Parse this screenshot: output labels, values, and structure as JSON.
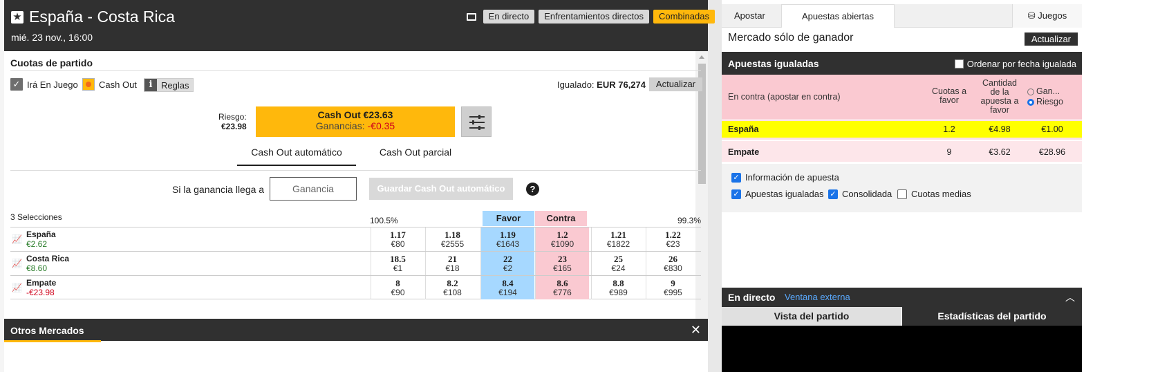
{
  "header": {
    "title": "España - Costa Rica",
    "date": "mié. 23 nov., 16:00",
    "buttons": [
      "En directo",
      "Enfrentamientos directos",
      "Combinadas"
    ]
  },
  "section_title": "Cuotas de partido",
  "options": {
    "ira": "Irá En Juego",
    "cashout": "Cash Out",
    "reglas": "Reglas",
    "igualado_label": "Igualado:",
    "igualado_value": "EUR 76,274",
    "actualizar": "Actualizar"
  },
  "riesgo": {
    "label": "Riesgo:",
    "value": "€23.98"
  },
  "cashout": {
    "main": "Cash Out €23.63",
    "gan_label": "Ganancias:",
    "gan_value": "-€0.35"
  },
  "tabs": [
    "Cash Out automático",
    "Cash Out parcial"
  ],
  "auto": {
    "si_label": "Si la ganancia llega a",
    "placeholder": "Ganancia",
    "guardar": "Guardar Cash Out automático",
    "help": "?"
  },
  "market": {
    "selections": "3 Selecciones",
    "pct_back": "100.5%",
    "pct_lay": "99.3%",
    "favor": "Favor",
    "contra": "Contra",
    "rows": [
      {
        "name": "España",
        "pl": "€2.62",
        "cells": [
          [
            "1.17",
            "€80"
          ],
          [
            "1.18",
            "€2555"
          ],
          [
            "1.19",
            "€1643"
          ],
          [
            "1.2",
            "€1090"
          ],
          [
            "1.21",
            "€1822"
          ],
          [
            "1.22",
            "€23"
          ]
        ]
      },
      {
        "name": "Costa Rica",
        "pl": "€8.60",
        "cells": [
          [
            "18.5",
            "€1"
          ],
          [
            "21",
            "€18"
          ],
          [
            "22",
            "€2"
          ],
          [
            "23",
            "€165"
          ],
          [
            "25",
            "€24"
          ],
          [
            "26",
            "€830"
          ]
        ]
      },
      {
        "name": "Empate",
        "pl": "-€23.98",
        "cells": [
          [
            "8",
            "€90"
          ],
          [
            "8.2",
            "€108"
          ],
          [
            "8.4",
            "€194"
          ],
          [
            "8.6",
            "€776"
          ],
          [
            "8.8",
            "€989"
          ],
          [
            "9",
            "€995"
          ]
        ]
      }
    ]
  },
  "otros": "Otros Mercados",
  "right": {
    "tabs": [
      "Apostar",
      "Apuestas abiertas",
      "Juegos"
    ],
    "mercado": "Mercado sólo de ganador",
    "actualizar": "Actualizar",
    "igualadas": "Apuestas igualadas",
    "ordenar": "Ordenar por fecha igualada",
    "head": {
      "c1": "En contra (apostar en contra)",
      "c2": "Cuotas a favor",
      "c3": "Cantidad de la apuesta a favor",
      "r1": "Gan...",
      "r2": "Riesgo"
    },
    "rows": [
      {
        "name": "España",
        "odds": "1.2",
        "stake": "€4.98",
        "risk": "€1.00"
      },
      {
        "name": "Empate",
        "odds": "9",
        "stake": "€3.62",
        "risk": "€28.96"
      }
    ],
    "checks": {
      "info": "Información de apuesta",
      "igual": "Apuestas igualadas",
      "cons": "Consolidada",
      "medias": "Cuotas medias"
    },
    "endirecto": "En directo",
    "ventana": "Ventana externa",
    "vista": "Vista del partido",
    "stats": "Estadísticas del partido"
  },
  "colors": {
    "header": "#303030",
    "accent": "#ffb80c",
    "favor": "#a6d8ff",
    "contra": "#fac9d1",
    "highlight": "#ffff00"
  }
}
